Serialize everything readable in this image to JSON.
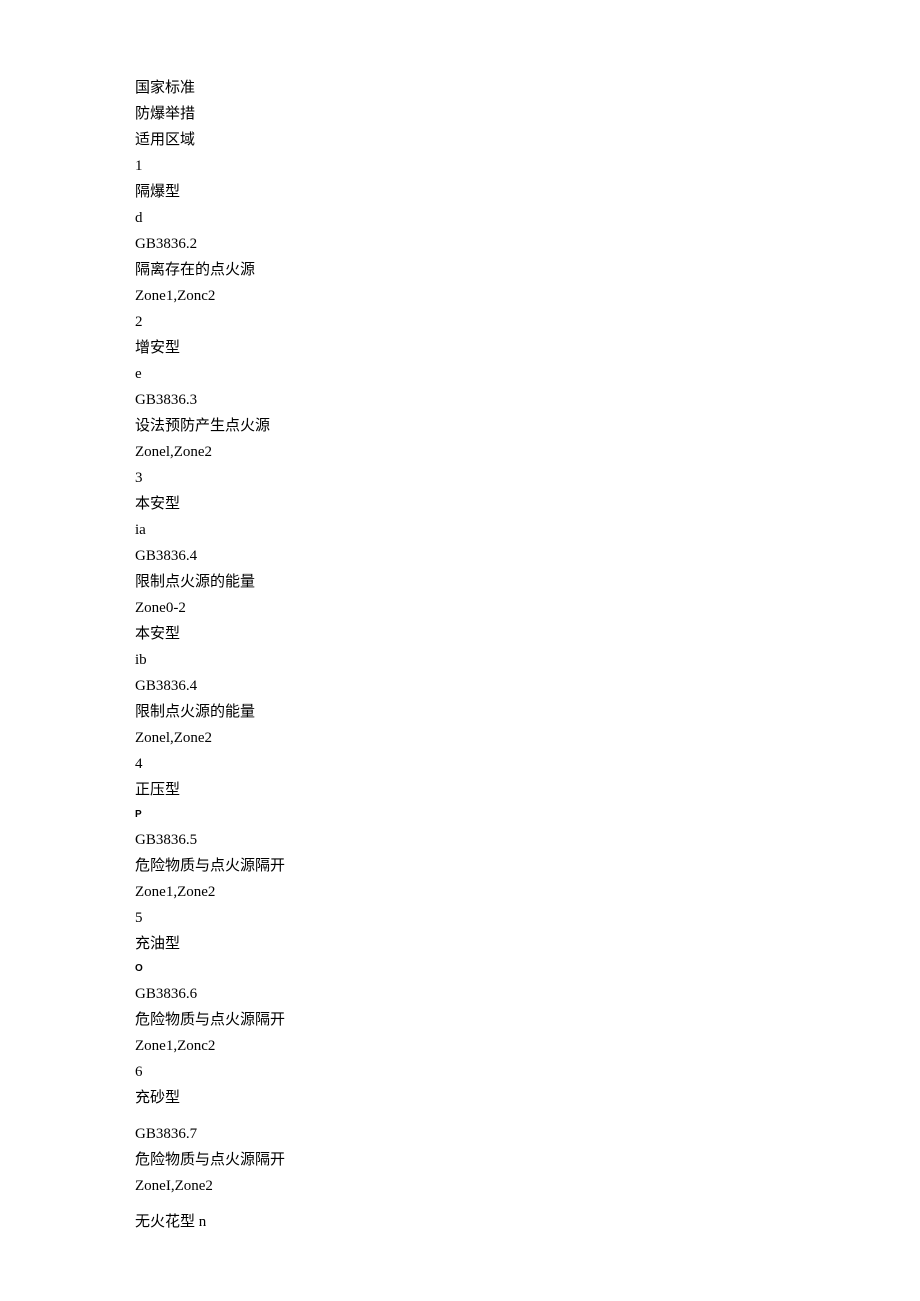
{
  "lines": [
    {
      "text": "国家标准",
      "cls": "line"
    },
    {
      "text": "防爆举措",
      "cls": "line"
    },
    {
      "text": "适用区域",
      "cls": "line"
    },
    {
      "text": "1",
      "cls": "line"
    },
    {
      "text": "隔爆型",
      "cls": "line"
    },
    {
      "text": "d",
      "cls": "line"
    },
    {
      "text": "GB3836.2",
      "cls": "line"
    },
    {
      "text": "隔离存在的点火源",
      "cls": "line"
    },
    {
      "text": "Zone1,Zonc2",
      "cls": "line"
    },
    {
      "text": "2",
      "cls": "line"
    },
    {
      "text": "增安型",
      "cls": "line"
    },
    {
      "text": "e",
      "cls": "line"
    },
    {
      "text": "GB3836.3",
      "cls": "line"
    },
    {
      "text": "设法预防产生点火源",
      "cls": "line"
    },
    {
      "text": "Zonel,Zone2",
      "cls": "line"
    },
    {
      "text": "3",
      "cls": "line"
    },
    {
      "text": "本安型",
      "cls": "line"
    },
    {
      "text": "ia",
      "cls": "line"
    },
    {
      "text": "GB3836.4",
      "cls": "line"
    },
    {
      "text": "限制点火源的能量",
      "cls": "line"
    },
    {
      "text": "Zone0-2",
      "cls": "line"
    },
    {
      "text": "本安型",
      "cls": "line"
    },
    {
      "text": "ib",
      "cls": "line"
    },
    {
      "text": "GB3836.4",
      "cls": "line"
    },
    {
      "text": "限制点火源的能量",
      "cls": "line"
    },
    {
      "text": "Zonel,Zone2",
      "cls": "line"
    },
    {
      "text": "4",
      "cls": "line"
    },
    {
      "text": "正压型",
      "cls": "line"
    },
    {
      "text": "P",
      "cls": "small-sans"
    },
    {
      "text": "GB3836.5",
      "cls": "line"
    },
    {
      "text": "危险物质与点火源隔开",
      "cls": "line"
    },
    {
      "text": "Zone1,Zone2",
      "cls": "line"
    },
    {
      "text": "5",
      "cls": "line"
    },
    {
      "text": "充油型",
      "cls": "line"
    },
    {
      "text": "O",
      "cls": "small-sans"
    },
    {
      "text": "GB3836.6",
      "cls": "line"
    },
    {
      "text": "危险物质与点火源隔开",
      "cls": "line"
    },
    {
      "text": "Zone1,Zonc2",
      "cls": "line"
    },
    {
      "text": "6",
      "cls": "line"
    },
    {
      "text": "充砂型",
      "cls": "line"
    },
    {
      "text": "",
      "cls": "gap"
    },
    {
      "text": "GB3836.7",
      "cls": "line"
    },
    {
      "text": "危险物质与点火源隔开",
      "cls": "line"
    },
    {
      "text": "ZoneI,Zone2",
      "cls": "line"
    },
    {
      "text": "无火花型 n",
      "cls": "line gap-above"
    }
  ]
}
